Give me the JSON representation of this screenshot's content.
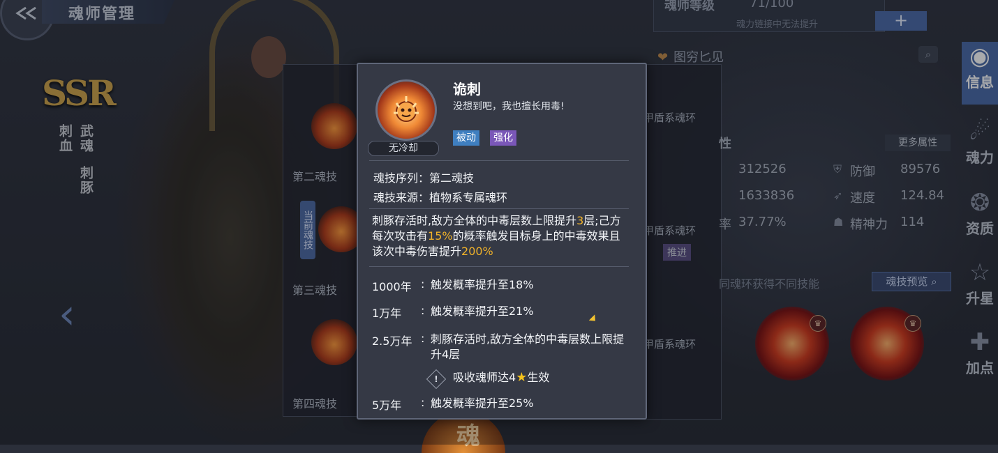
{
  "header": {
    "title": "魂师管理"
  },
  "character": {
    "rarity": "SSR",
    "martial_soul_label": "武魂",
    "martial_soul": "刺豚",
    "blood_label": "刺血"
  },
  "skill_list": {
    "items": [
      "第二魂技",
      "第三魂技",
      "第四魂技"
    ],
    "current_tag": "当前魂技"
  },
  "right": {
    "level_label": "魂师等级",
    "level_value": "71/100",
    "level_hint": "魂力链接中无法提升",
    "plus": "+",
    "section_title": "图穷匕见",
    "ring_texts": [
      "甲盾系魂环",
      "甲盾系魂环",
      "甲盾系魂环"
    ],
    "tag_push": "推进",
    "attr_header": "性",
    "more_attr": "更多属性",
    "attrs": {
      "hp": "312526",
      "def_label": "防御",
      "def": "89576",
      "atk": "1633836",
      "spd_label": "速度",
      "spd": "124.84",
      "rate_label": "率",
      "rate": "37.77%",
      "mind_label": "精神力",
      "mind": "114"
    },
    "preview_hint": "同魂环获得不同技能",
    "preview_btn": "魂技预览"
  },
  "side_tabs": [
    "信息",
    "魂力",
    "资质",
    "升星",
    "加点"
  ],
  "bottom_char": "魂",
  "tooltip": {
    "name": "诡刺",
    "quote": "没想到吧，我也擅长用毒!",
    "cooldown": "无冷却",
    "tags": {
      "passive": "被动",
      "enhance": "强化"
    },
    "order_label": "魂技序列：",
    "order_value": "第二魂技",
    "source_label": "魂技来源：",
    "source_value": "植物系专属魂环",
    "desc": {
      "p1": "刺豚存活时,敌方全体的中毒层数上限提升",
      "v1": "3",
      "p2": "层;己方每次攻击有",
      "v2": "15%",
      "p3": "的概率触发目标身上的中毒效果且该次中毒伤害提升",
      "v3": "200%"
    },
    "years": [
      {
        "label": "1000年",
        "text": "触发概率提升至18%"
      },
      {
        "label": "1万年",
        "text": "触发概率提升至21%"
      },
      {
        "label": "2.5万年",
        "text": "刺豚存活时,敌方全体的中毒层数上限提升4层"
      },
      {
        "label": "5万年",
        "text": "触发概率提升至25%"
      }
    ],
    "colon": ":",
    "condition_pre": "吸收魂师达4",
    "condition_post": "生效",
    "warn_icon": "!"
  },
  "colors": {
    "highlight": "#f0b22a",
    "passive": "#3f7fc0",
    "enhance": "#7a57b8",
    "active_tab": "#4b6aa8"
  }
}
